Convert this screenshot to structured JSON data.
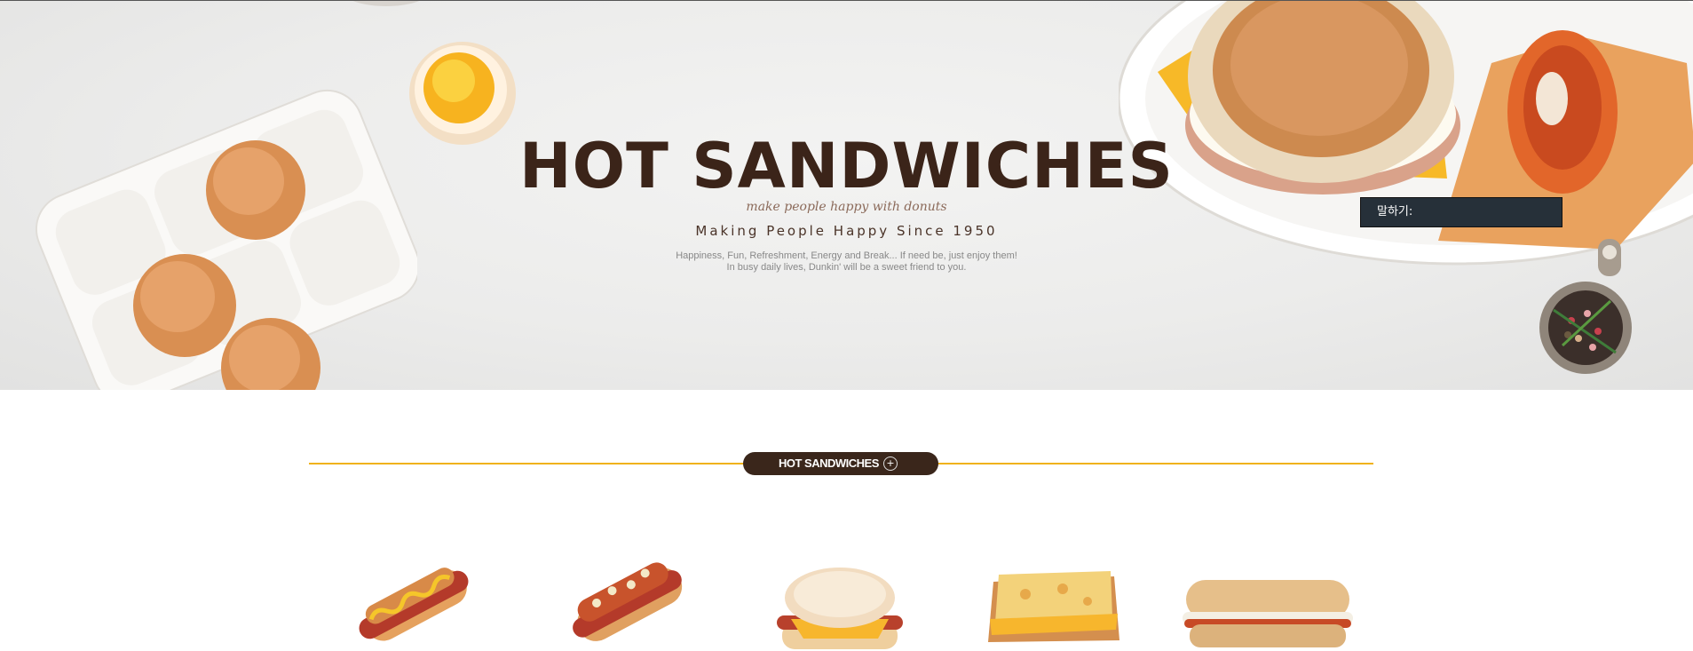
{
  "hero": {
    "title": "HOT SANDWICHES",
    "script_line": "make people happy with donuts",
    "subtitle": "Making People Happy Since 1950",
    "description_line1": "Happiness, Fun, Refreshment, Energy and Break... If need be, just enjoy them!",
    "description_line2": "In busy daily lives, Dunkin' will be a sweet friend to you."
  },
  "tooltip": {
    "text": "말하기:"
  },
  "section": {
    "label": "HOT SANDWICHES",
    "more_icon": "+",
    "accent_color": "#f0b21a",
    "pill_color": "#3a261b"
  },
  "products": [
    {
      "icon": "hotdog-mustard-image"
    },
    {
      "icon": "hotdog-chili-image"
    },
    {
      "icon": "bacon-muffin-image"
    },
    {
      "icon": "cheese-toast-image"
    },
    {
      "icon": "ciabatta-sandwich-image"
    }
  ]
}
